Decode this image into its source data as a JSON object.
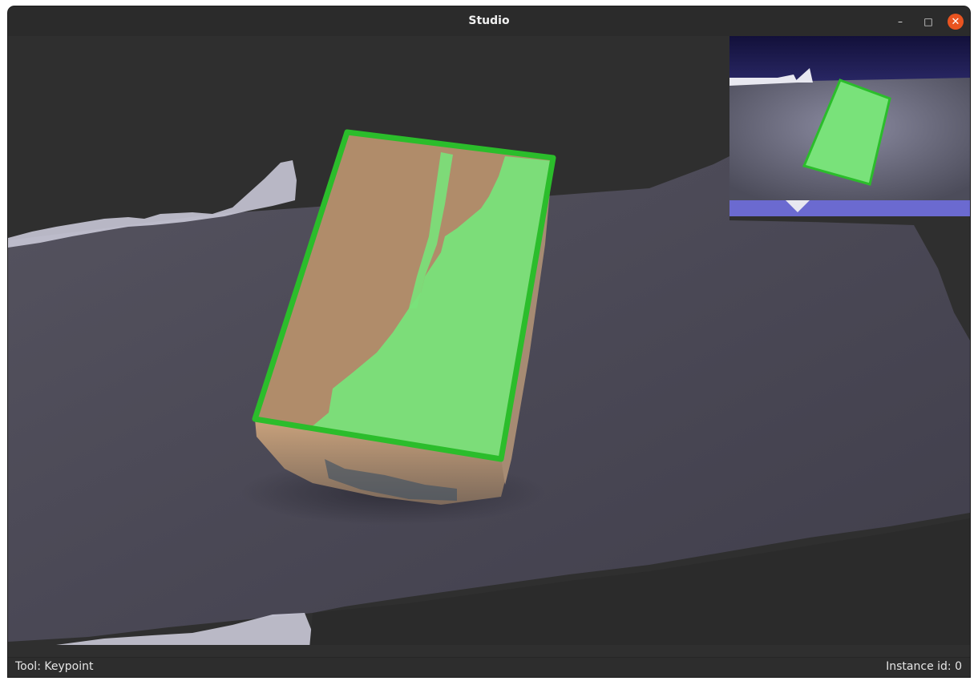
{
  "window": {
    "title": "Studio",
    "controls": {
      "minimize": "–",
      "maximize": "□",
      "close": "✕"
    }
  },
  "statusbar": {
    "tool": "Tool: Keypoint",
    "instance": "Instance id: 0"
  },
  "colors": {
    "background": "#2f2f2f",
    "surface": "#4a4856",
    "box_top": "#b08c6a",
    "annotation_fill": "#7be07b",
    "annotation_outline": "#2bbd2b",
    "inset_sky": "#1a1848",
    "close_button": "#e95420"
  },
  "icons": {
    "minimize": "minimize-icon",
    "maximize": "maximize-icon",
    "close": "close-icon"
  }
}
